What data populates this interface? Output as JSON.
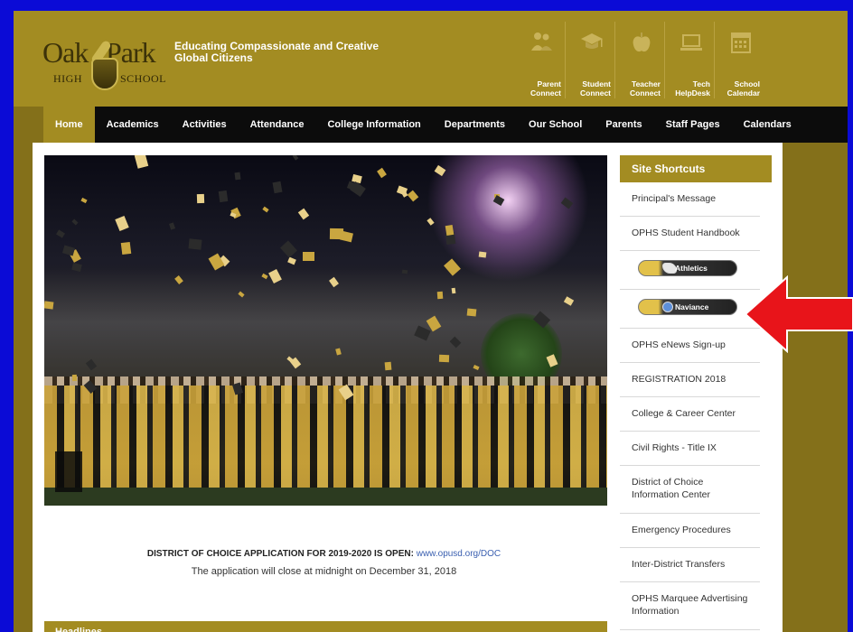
{
  "header": {
    "logo": {
      "oak": "Oak",
      "park": "Park",
      "high": "HIGH",
      "school": "SCHOOL"
    },
    "tagline": "Educating Compassionate and Creative Global Citizens",
    "quicklinks": [
      {
        "label": "Parent Connect",
        "icon": "parents-icon"
      },
      {
        "label": "Student Connect",
        "icon": "graduation-cap-icon"
      },
      {
        "label": "Teacher Connect",
        "icon": "apple-icon"
      },
      {
        "label": "Tech HelpDesk",
        "icon": "laptop-icon"
      },
      {
        "label": "School Calendar",
        "icon": "calendar-icon"
      }
    ]
  },
  "nav": {
    "items": [
      "Home",
      "Academics",
      "Activities",
      "Attendance",
      "College Information",
      "Departments",
      "Our School",
      "Parents",
      "Staff Pages",
      "Calendars"
    ],
    "active": "Home"
  },
  "main": {
    "notice_bold": "DISTRICT OF CHOICE APPLICATION FOR 2019-2020 IS OPEN:",
    "notice_link": "www.opusd.org/DOC",
    "notice_line2": "The application will close at midnight on December 31, 2018",
    "headlines_title": "Headlines"
  },
  "sidebar": {
    "title": "Site Shortcuts",
    "items": [
      "Principal's Message",
      "OPHS Student Handbook",
      "Athletics",
      "Naviance",
      "OPHS eNews Sign-up",
      "REGISTRATION 2018",
      "College & Career Center",
      "Civil Rights - Title IX",
      "District of Choice Information Center",
      "Emergency Procedures",
      "Inter-District Transfers",
      "OPHS Marquee Advertising Information"
    ]
  },
  "colors": {
    "gold": "#a38c22",
    "dark_gold": "#84701a",
    "nav_black": "#0c0c0c",
    "outer_blue": "#0b0bd6",
    "arrow_red": "#e8141a"
  }
}
